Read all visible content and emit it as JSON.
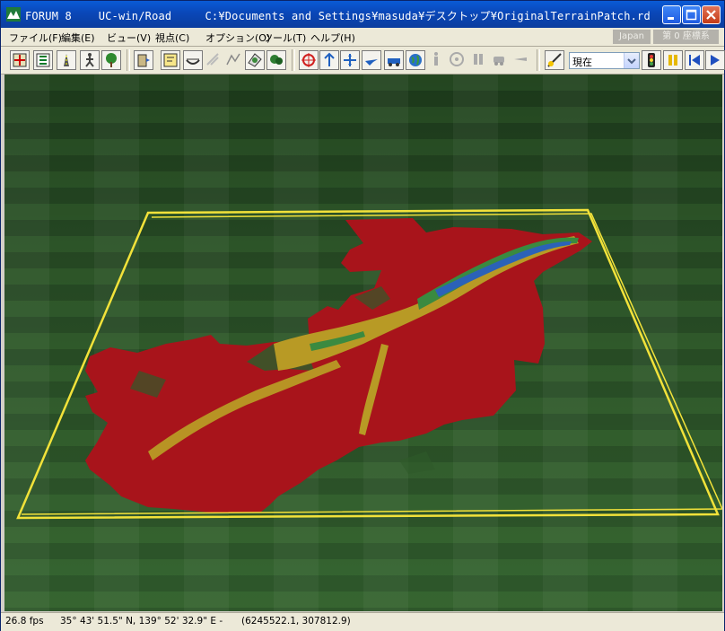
{
  "titlebar": {
    "brand": "FORUM 8",
    "app": "UC-win/Road",
    "path": "C:¥Documents and Settings¥masuda¥デスクトップ¥OriginalTerrainPatch.rd"
  },
  "menu": [
    {
      "label": "ファイル(F)"
    },
    {
      "label": "編集(E)"
    },
    {
      "label": "ビュー(V)"
    },
    {
      "label": "視点(C)"
    },
    {
      "label": "オプション(O)"
    },
    {
      "label": "ツール(T)"
    },
    {
      "label": "ヘルプ(H)"
    }
  ],
  "region": "Japan",
  "coordinate_system": "第 0 座標系",
  "time_select": {
    "value": "現在"
  },
  "status": {
    "fps": "26.8 fps",
    "latlon": "35° 43' 51.5\" N, 139° 52' 32.9\" E -",
    "xy": "(6245522.1, 307812.9)"
  },
  "colors": {
    "title_bar": "#0a47b8",
    "terrain_green": "#2f5a2a",
    "patch_red": "#a8141b",
    "river_yellow": "#b89a25",
    "river_blue": "#2b62b8",
    "boundary_yellow": "#f2e23a"
  }
}
